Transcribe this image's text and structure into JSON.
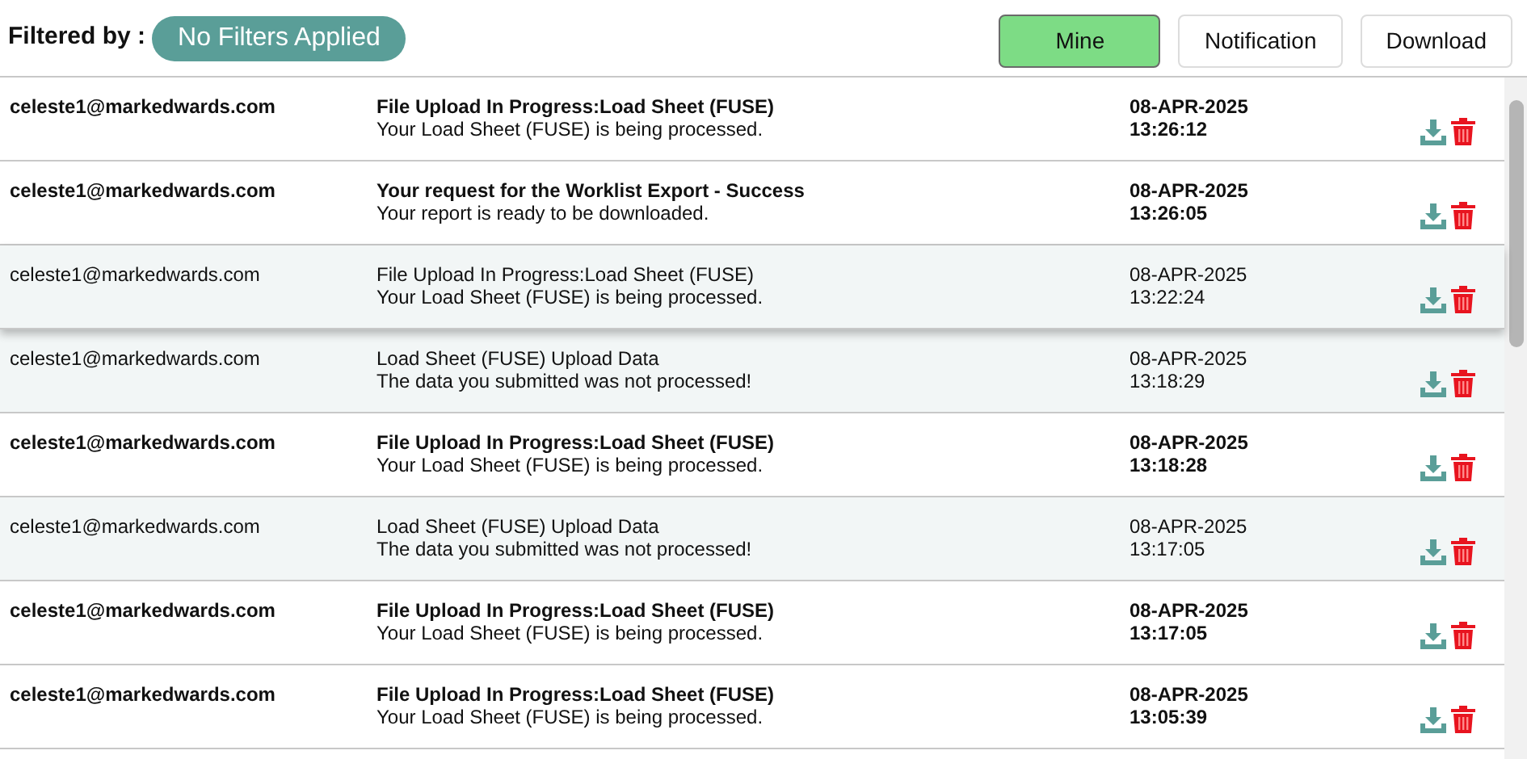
{
  "filter": {
    "label": "Filtered by :",
    "badge": "No Filters Applied"
  },
  "buttons": [
    {
      "label": "Mine",
      "selected": true
    },
    {
      "label": "Notification",
      "selected": false
    },
    {
      "label": "Download",
      "selected": false
    }
  ],
  "rows": [
    {
      "user": "celeste1@markedwards.com",
      "title": "File Upload In Progress:Load Sheet (FUSE)",
      "message": "Your Load Sheet (FUSE) is being processed.",
      "date": "08-APR-2025",
      "time": "13:26:12",
      "unread": true,
      "hovered": false
    },
    {
      "user": "celeste1@markedwards.com",
      "title": "Your request for the Worklist Export - Success",
      "message": "Your report is ready to be downloaded.",
      "date": "08-APR-2025",
      "time": "13:26:05",
      "unread": true,
      "hovered": false
    },
    {
      "user": "celeste1@markedwards.com",
      "title": "File Upload In Progress:Load Sheet (FUSE)",
      "message": "Your Load Sheet (FUSE) is being processed.",
      "date": "08-APR-2025",
      "time": "13:22:24",
      "unread": false,
      "hovered": true
    },
    {
      "user": "celeste1@markedwards.com",
      "title": "Load Sheet (FUSE) Upload Data",
      "message": "The data you submitted was not processed!",
      "date": "08-APR-2025",
      "time": "13:18:29",
      "unread": false,
      "hovered": false
    },
    {
      "user": "celeste1@markedwards.com",
      "title": "File Upload In Progress:Load Sheet (FUSE)",
      "message": "Your Load Sheet (FUSE) is being processed.",
      "date": "08-APR-2025",
      "time": "13:18:28",
      "unread": true,
      "hovered": false
    },
    {
      "user": "celeste1@markedwards.com",
      "title": "Load Sheet (FUSE) Upload Data",
      "message": "The data you submitted was not processed!",
      "date": "08-APR-2025",
      "time": "13:17:05",
      "unread": false,
      "hovered": false
    },
    {
      "user": "celeste1@markedwards.com",
      "title": "File Upload In Progress:Load Sheet (FUSE)",
      "message": "Your Load Sheet (FUSE) is being processed.",
      "date": "08-APR-2025",
      "time": "13:17:05",
      "unread": true,
      "hovered": false
    },
    {
      "user": "celeste1@markedwards.com",
      "title": "File Upload In Progress:Load Sheet (FUSE)",
      "message": "Your Load Sheet (FUSE) is being processed.",
      "date": "08-APR-2025",
      "time": "13:05:39",
      "unread": true,
      "hovered": false
    }
  ]
}
